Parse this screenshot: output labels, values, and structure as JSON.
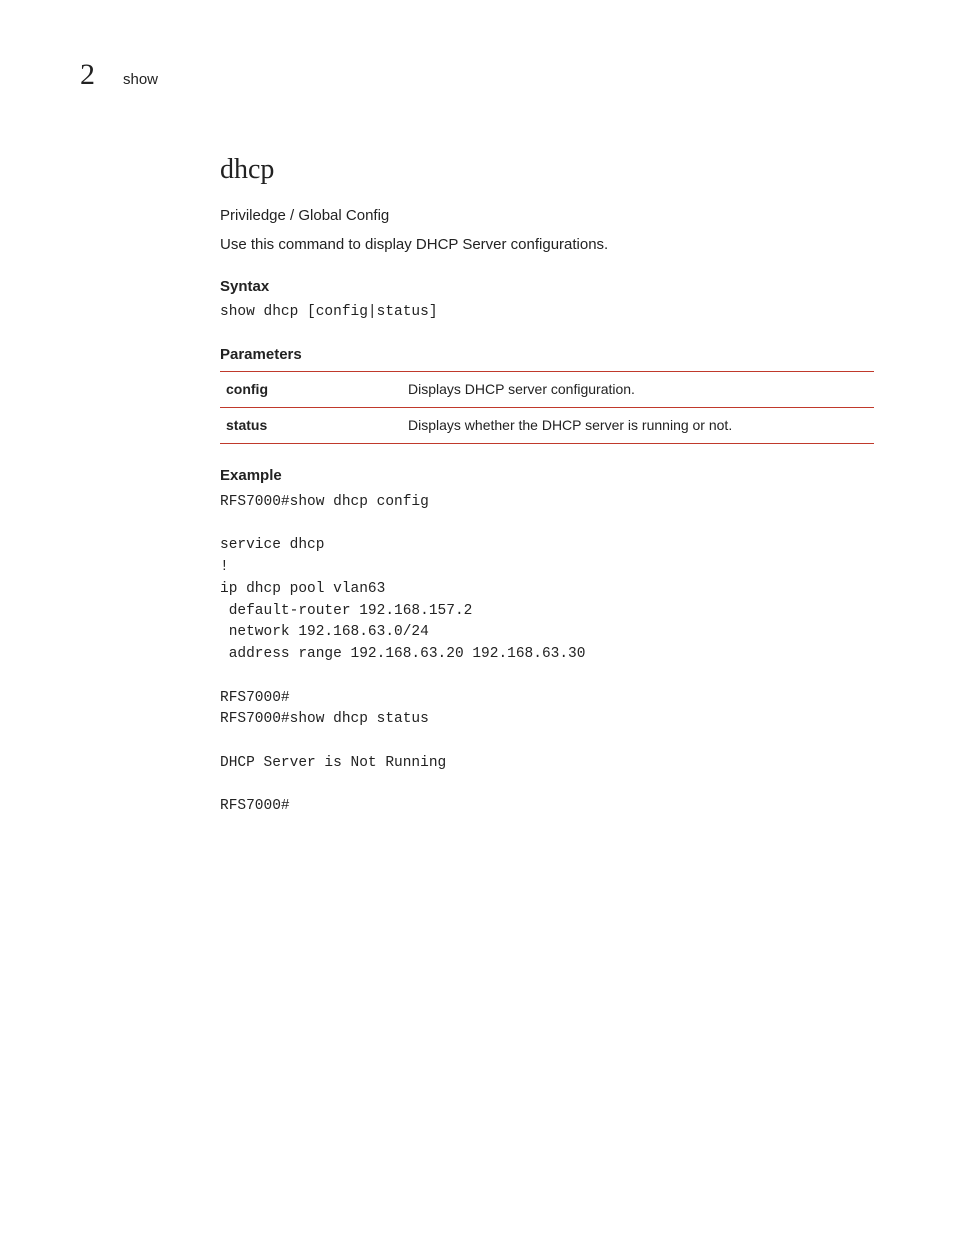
{
  "header": {
    "chapter_number": "2",
    "breadcrumb": "show"
  },
  "title": "dhcp",
  "context_line": "Priviledge / Global Config",
  "description": "Use this command to display DHCP Server configurations.",
  "syntax": {
    "heading": "Syntax",
    "code": "show dhcp [config|status]"
  },
  "parameters": {
    "heading": "Parameters",
    "rows": [
      {
        "name": "config",
        "desc": "Displays DHCP server configuration."
      },
      {
        "name": "status",
        "desc": "Displays whether the DHCP server is running or not."
      }
    ]
  },
  "example": {
    "heading": "Example",
    "code": "RFS7000#show dhcp config\n\nservice dhcp\n!\nip dhcp pool vlan63\n default-router 192.168.157.2\n network 192.168.63.0/24\n address range 192.168.63.20 192.168.63.30\n\nRFS7000#\nRFS7000#show dhcp status\n\nDHCP Server is Not Running\n\nRFS7000#"
  }
}
